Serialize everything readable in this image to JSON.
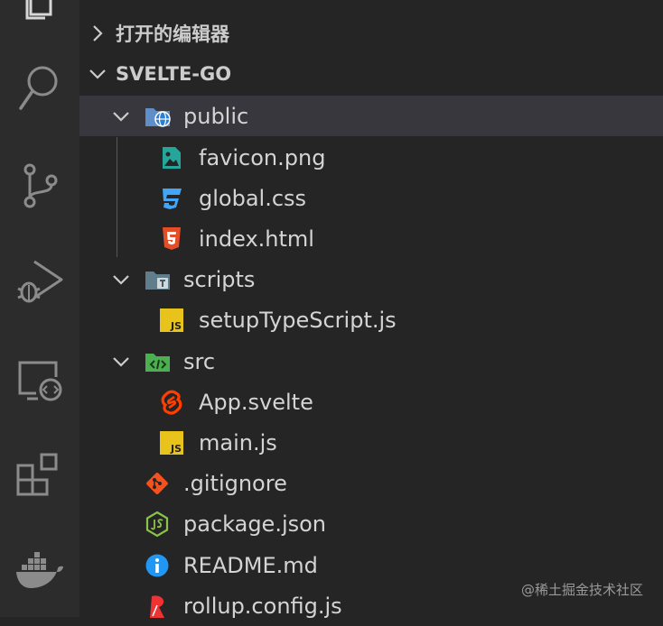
{
  "explorer": {
    "open_editors_label": "打开的编辑器",
    "project_label": "SVELTE-GO"
  },
  "tree": [
    {
      "label": "public",
      "type": "folder",
      "icon": "folder-public-icon",
      "expanded": true,
      "selected": true
    },
    {
      "label": "favicon.png",
      "type": "file",
      "icon": "image-file-icon"
    },
    {
      "label": "global.css",
      "type": "file",
      "icon": "css-file-icon"
    },
    {
      "label": "index.html",
      "type": "file",
      "icon": "html-file-icon"
    },
    {
      "label": "scripts",
      "type": "folder",
      "icon": "folder-scripts-icon",
      "expanded": true
    },
    {
      "label": "setupTypeScript.js",
      "type": "file",
      "icon": "js-file-icon"
    },
    {
      "label": "src",
      "type": "folder",
      "icon": "folder-src-icon",
      "expanded": true
    },
    {
      "label": "App.svelte",
      "type": "file",
      "icon": "svelte-file-icon"
    },
    {
      "label": "main.js",
      "type": "file",
      "icon": "js-file-icon"
    },
    {
      "label": ".gitignore",
      "type": "file",
      "icon": "git-file-icon"
    },
    {
      "label": "package.json",
      "type": "file",
      "icon": "nodejs-file-icon"
    },
    {
      "label": "README.md",
      "type": "file",
      "icon": "info-file-icon"
    },
    {
      "label": "rollup.config.js",
      "type": "file",
      "icon": "rollup-file-icon"
    }
  ],
  "js_badge_text": "JS",
  "watermark": "@稀土掘金技术社区",
  "colors": {
    "activity_bar": "#2c2c2c",
    "sidebar": "#252526",
    "selected_row": "#37373d",
    "js": "#e8c31c",
    "html": "#e44d26",
    "css": "#42a5f5",
    "svelte": "#ff3e00",
    "git": "#f4511e",
    "node": "#8bc34a",
    "info": "#2196f3"
  }
}
